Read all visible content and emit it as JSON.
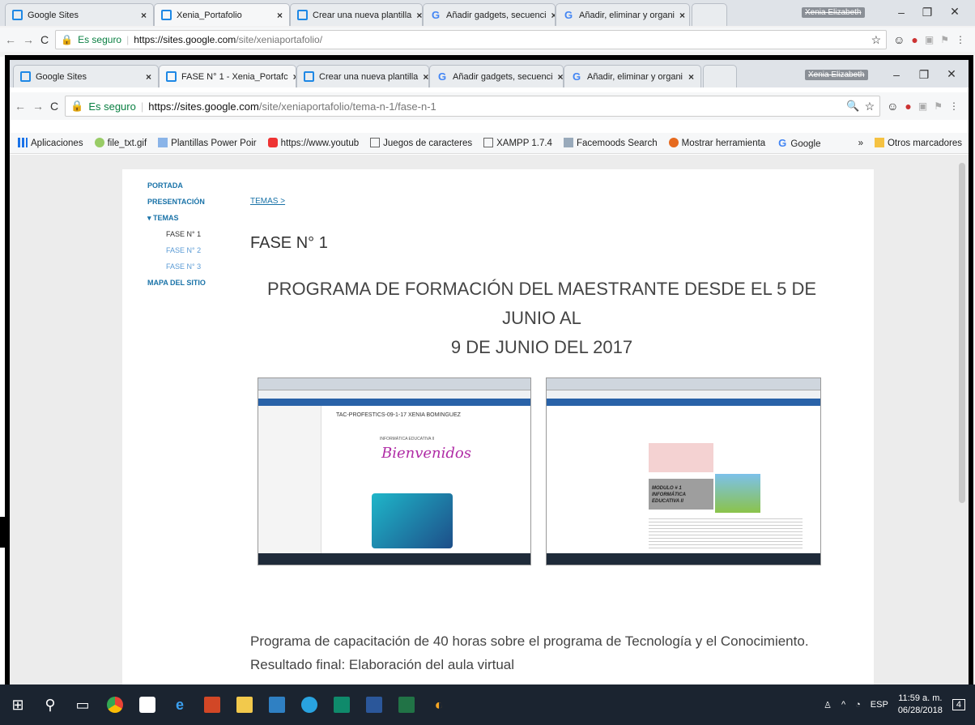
{
  "outer_browser": {
    "tabs": [
      {
        "label": "Google Sites",
        "favicon": "sites-icon"
      },
      {
        "label": "Xenia_Portafolio",
        "favicon": "sites-icon"
      },
      {
        "label": "Crear una nueva plantilla",
        "favicon": "sites-icon"
      },
      {
        "label": "Añadir gadgets, secuenci",
        "favicon": "google-icon"
      },
      {
        "label": "Añadir, eliminar y organi",
        "favicon": "google-icon"
      }
    ],
    "profile": "Xenia Elizabeth",
    "secure_label": "Es seguro",
    "url_host": "https://sites.google.com",
    "url_path": "/site/xeniaportafolio/"
  },
  "inner_browser": {
    "tabs": [
      {
        "label": "Google Sites",
        "favicon": "sites-icon"
      },
      {
        "label": "FASE N° 1 - Xenia_Portafc",
        "favicon": "sites-icon"
      },
      {
        "label": "Crear una nueva plantilla",
        "favicon": "sites-icon"
      },
      {
        "label": "Añadir gadgets, secuenci",
        "favicon": "google-icon"
      },
      {
        "label": "Añadir, eliminar y organi",
        "favicon": "google-icon"
      }
    ],
    "profile": "Xenia Elizabeth",
    "secure_label": "Es seguro",
    "url_host": "https://sites.google.com",
    "url_path": "/site/xeniaportafolio/tema-n-1/fase-n-1",
    "bookmarks": [
      {
        "label": "Aplicaciones",
        "icon": "apps-icon"
      },
      {
        "label": "file_txt.gif",
        "icon": "bookmark-image-icon"
      },
      {
        "label": "Plantillas Power Poir",
        "icon": "bookmark-page-icon"
      },
      {
        "label": "https://www.youtub",
        "icon": "youtube-icon"
      },
      {
        "label": "Juegos de caracteres",
        "icon": "document-icon"
      },
      {
        "label": "XAMPP 1.7.4",
        "icon": "document-icon"
      },
      {
        "label": "Facemoods Search",
        "icon": "facemoods-icon"
      },
      {
        "label": "Mostrar herramienta",
        "icon": "firefox-icon"
      },
      {
        "label": "Google",
        "icon": "google-icon"
      }
    ],
    "bookmarks_more": "»",
    "other_bookmarks": "Otros marcadores"
  },
  "site": {
    "nav": [
      {
        "label": "PORTADA",
        "level": 0
      },
      {
        "label": "PRESENTACIÓN",
        "level": 0
      },
      {
        "label": "TEMAS",
        "level": 0,
        "expanded": true
      },
      {
        "label": "FASE N° 1",
        "level": 1,
        "current": true
      },
      {
        "label": "FASE N° 2",
        "level": 1
      },
      {
        "label": "FASE N° 3",
        "level": 1
      },
      {
        "label": "MAPA DEL SITIO",
        "level": 0
      }
    ],
    "breadcrumb": "TEMAS >",
    "page_title": "FASE N° 1",
    "heading_line1": "PROGRAMA DE  FORMACIÓN DEL MAESTRANTE DESDE EL 5 DE JUNIO AL",
    "heading_line2": "9 DE JUNIO DEL 2017",
    "screenshot1": {
      "title": "TAC-PROFESTICS-09-1-17 XENIA BOMINGUEZ",
      "subtitle": "INFORMÁTICA EDUCATIVA II",
      "welcome": "Bienvenidos"
    },
    "screenshot2": {
      "module": "MODULO # 1",
      "module_sub": "INFORMÁTICA EDUCATIVA II"
    },
    "paragraph_line1": "Programa de capacitación de 40 horas sobre el programa de Tecnología y el Conocimiento.",
    "paragraph_line2": "Resultado final: Elaboración del aula virtual"
  },
  "taskbar": {
    "language": "ESP",
    "time": "11:59 a. m.",
    "date": "06/28/2018",
    "notifications": "4"
  },
  "colors": {
    "accent": "#1a73a8",
    "taskbar": "#1b2430"
  }
}
